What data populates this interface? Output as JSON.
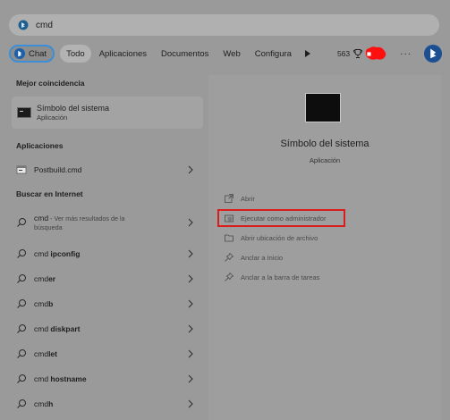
{
  "search": {
    "value": "cmd"
  },
  "filters": {
    "chat": "Chat",
    "tabs": [
      "Todo",
      "Aplicaciones",
      "Documentos",
      "Web",
      "Configura"
    ],
    "points": "563"
  },
  "left": {
    "best_match_header": "Mejor coincidencia",
    "best_match": {
      "title": "Símbolo del sistema",
      "subtitle": "Aplicación"
    },
    "apps_header": "Aplicaciones",
    "apps": [
      {
        "label": "Postbuild.cmd"
      }
    ],
    "web_header": "Buscar en Internet",
    "web_first": {
      "prefix": "cmd",
      "rest": " - Ver más resultados de la",
      "line2": "búsqueda"
    },
    "web_items": [
      {
        "prefix": "cmd ",
        "bold": "ipconfig"
      },
      {
        "prefix": "cmd",
        "bold": "er"
      },
      {
        "prefix": "cmd",
        "bold": "b"
      },
      {
        "prefix": "cmd ",
        "bold": "diskpart"
      },
      {
        "prefix": "cmd",
        "bold": "let"
      },
      {
        "prefix": "cmd ",
        "bold": "hostname"
      },
      {
        "prefix": "cmd",
        "bold": "h"
      }
    ]
  },
  "right": {
    "title": "Símbolo del sistema",
    "subtitle": "Aplicación",
    "actions": [
      {
        "label": "Abrir",
        "icon": "open-icon"
      },
      {
        "label": "Ejecutar como administrador",
        "icon": "shield-icon"
      },
      {
        "label": "Abrir ubicación de archivo",
        "icon": "folder-icon"
      },
      {
        "label": "Anclar a Inicio",
        "icon": "pin-icon"
      },
      {
        "label": "Anclar a la barra de tareas",
        "icon": "pin-icon"
      }
    ]
  },
  "colors": {
    "highlight": "#d91c1c",
    "accent": "#3c8fd6"
  }
}
